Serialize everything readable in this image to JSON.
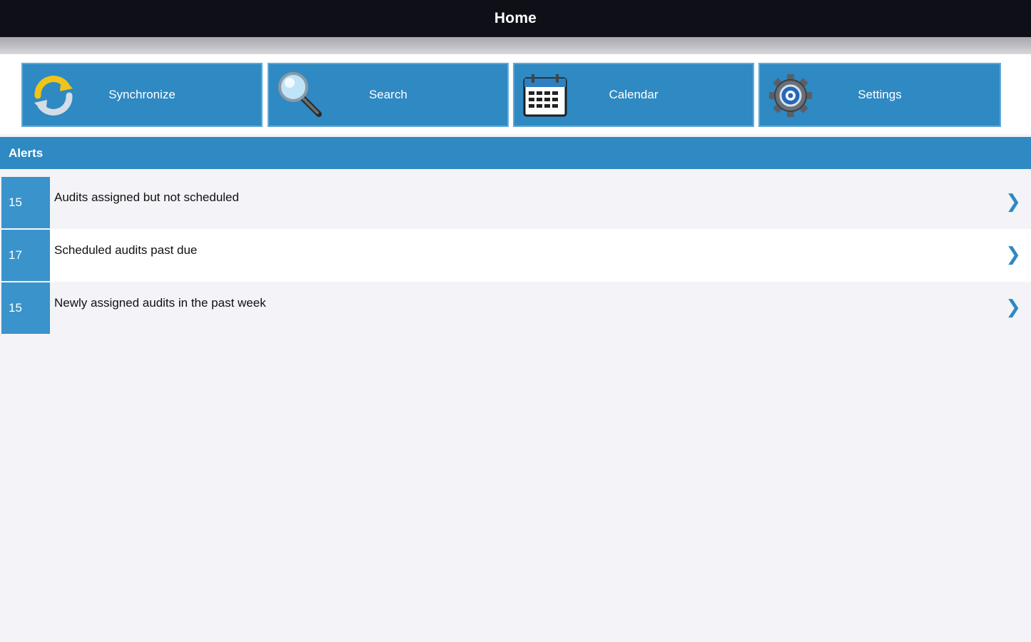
{
  "header": {
    "title": "Home"
  },
  "toolbar": {
    "tiles": [
      {
        "label": "Synchronize",
        "icon": "sync-icon"
      },
      {
        "label": "Search",
        "icon": "magnifier-icon"
      },
      {
        "label": "Calendar",
        "icon": "calendar-icon"
      },
      {
        "label": "Settings",
        "icon": "gear-icon"
      }
    ]
  },
  "alerts": {
    "title": "Alerts",
    "items": [
      {
        "count": "15",
        "text": "Audits assigned but not scheduled"
      },
      {
        "count": "17",
        "text": "Scheduled audits past due"
      },
      {
        "count": "15",
        "text": "Newly assigned audits in the past week"
      }
    ],
    "chevron": "❯"
  },
  "colors": {
    "accent": "#2f89c2",
    "titlebar": "#0f0f17",
    "background": "#f4f3f8"
  }
}
